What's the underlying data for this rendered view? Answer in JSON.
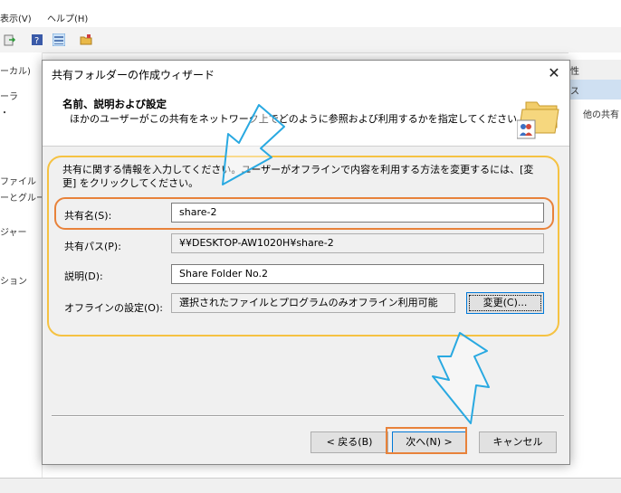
{
  "background": {
    "menu": [
      "表示(V)",
      "ヘルプ(H)"
    ],
    "left_items": [
      "ーカル)",
      "ーラ",
      "・",
      "ファイル",
      "ーとグループ",
      "ジャー",
      "ション"
    ],
    "right_items": [
      "性",
      "ス",
      "他の共有"
    ]
  },
  "dialog": {
    "title": "共有フォルダーの作成ウィザード",
    "close_glyph": "✕",
    "header": {
      "title": "名前、説明および設定",
      "description": "ほかのユーザーがこの共有をネットワーク上でどのように参照および利用するかを指定してください。"
    },
    "intro": "共有に関する情報を入力してください。ユーザーがオフラインで内容を利用する方法を変更するには、[変更] をクリックしてください。",
    "fields": {
      "share_name": {
        "label": "共有名(S):",
        "value": "share-2"
      },
      "share_path": {
        "label": "共有パス(P):",
        "value": "¥¥DESKTOP-AW1020H¥share-2"
      },
      "description": {
        "label": "説明(D):",
        "value": "Share Folder No.2"
      },
      "offline": {
        "label": "オフラインの設定(O):",
        "value": "選択されたファイルとプログラムのみオフライン利用可能",
        "change_button": "変更(C)..."
      }
    },
    "buttons": {
      "back": "< 戻る(B)",
      "next": "次へ(N) >",
      "cancel": "キャンセル"
    }
  },
  "colors": {
    "highlight_yellow": "#f5c242",
    "highlight_orange": "#e8823a",
    "arrow_blue": "#29a9e1"
  }
}
